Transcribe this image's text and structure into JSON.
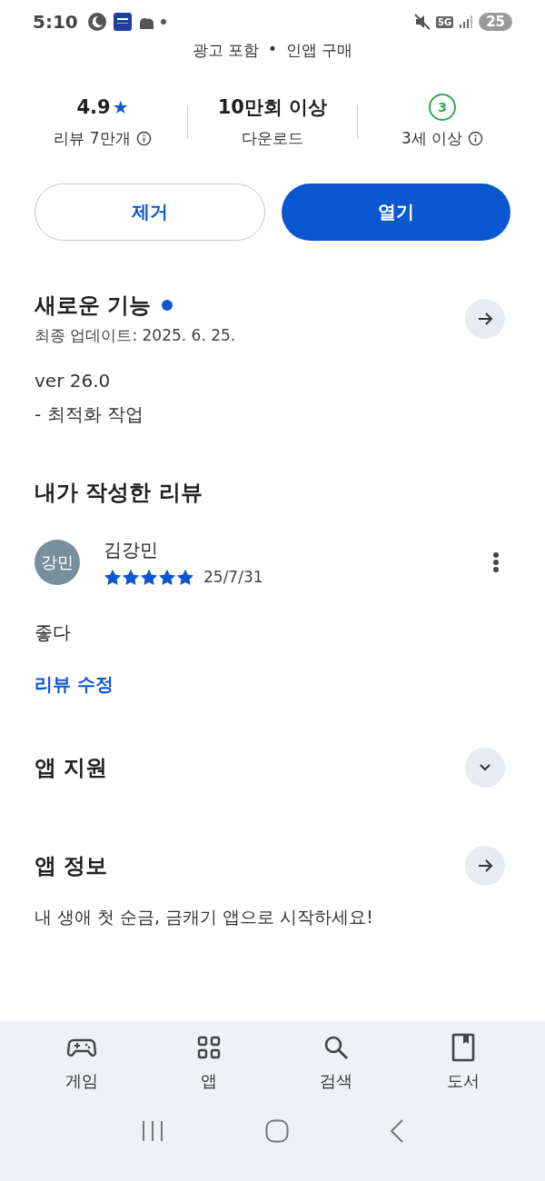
{
  "status_bar": {
    "time": "5:10",
    "network": "5G",
    "battery": "25"
  },
  "tagline": {
    "left": "광고 포함",
    "separator": "•",
    "right": "인앱 구매"
  },
  "stats": [
    {
      "kind": "rating",
      "value": "4.9",
      "star": "★",
      "label": "리뷰 7만개",
      "info": true
    },
    {
      "kind": "text",
      "value": "10만회 이상",
      "label": "다운로드",
      "info": false
    },
    {
      "kind": "age",
      "value": "3",
      "label": "3세 이상",
      "info": true
    }
  ],
  "buttons": [
    {
      "label": "제거",
      "kind": "outline"
    },
    {
      "label": "열기",
      "kind": "filled"
    }
  ],
  "whats_new": {
    "title": "새로운 기능",
    "new_dot": true,
    "updated": "최종 업데이트: 2025. 6. 25.",
    "lines": [
      "ver 26.0",
      "- 최적화 작업"
    ]
  },
  "my_review": {
    "title": "내가 작성한 리뷰",
    "avatar": "강민",
    "name": "김강민",
    "stars": 5,
    "date": "25/7/31",
    "text": "좋다",
    "edit_link": "리뷰 수정"
  },
  "sections": [
    {
      "title": "앱 지원",
      "kind": "expand"
    },
    {
      "title": "앱 정보",
      "kind": "arrow"
    }
  ],
  "description": "내 생애 첫 순금, 금캐기 앱으로 시작하세요!",
  "bottom_nav": [
    {
      "label": "게임",
      "kind": "games"
    },
    {
      "label": "앱",
      "kind": "apps"
    },
    {
      "label": "검색",
      "kind": "search"
    },
    {
      "label": "도서",
      "kind": "books"
    }
  ]
}
